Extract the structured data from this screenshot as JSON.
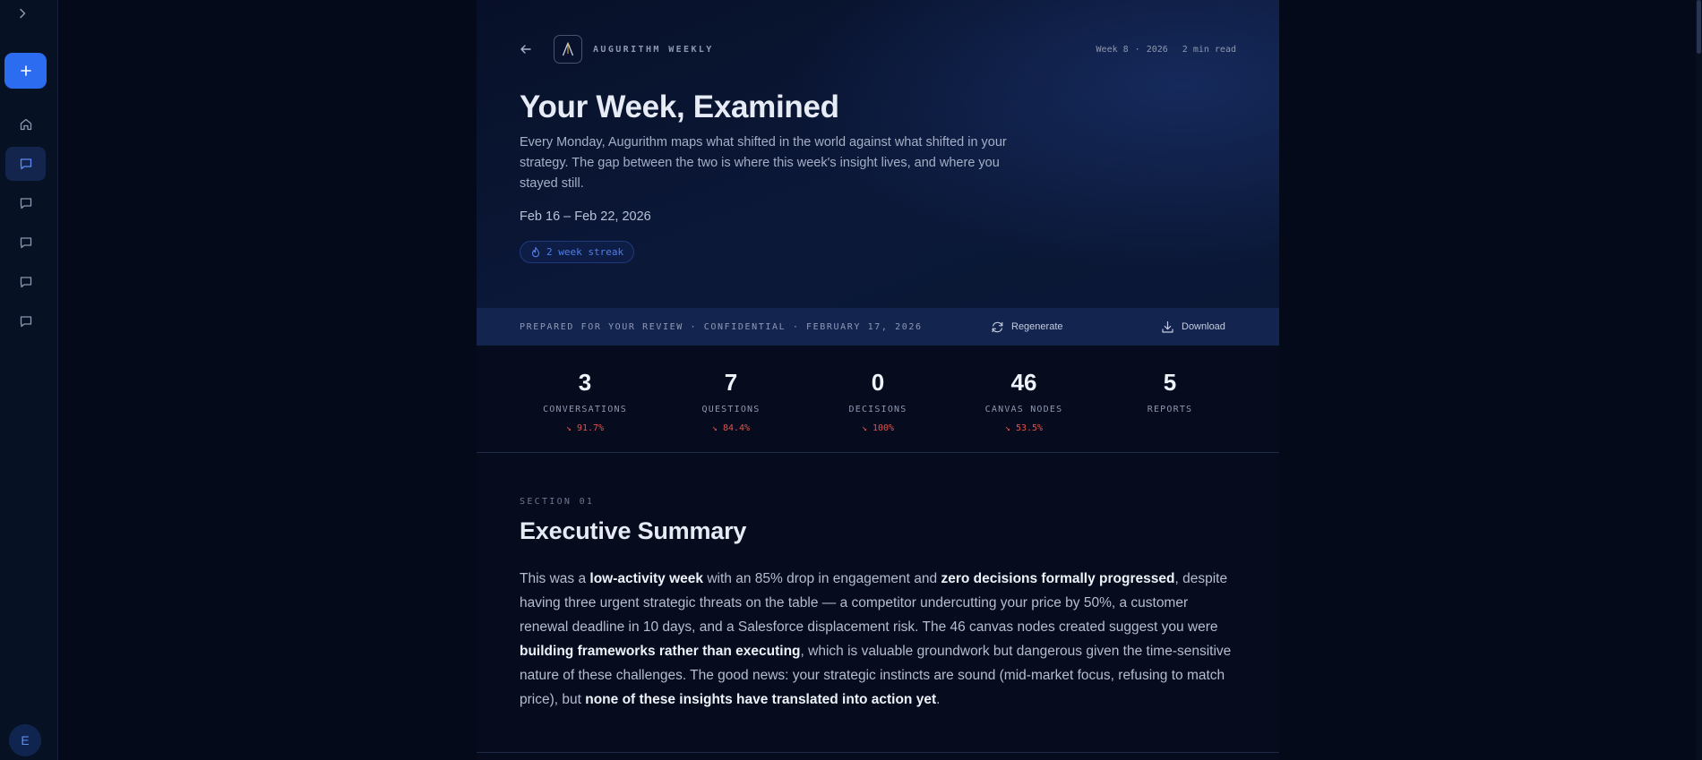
{
  "header": {
    "brand": "AUGURITHM WEEKLY",
    "week": "Week 8",
    "year": "2026",
    "separator": "·",
    "read_time": "2 min read"
  },
  "hero": {
    "title": "Your Week, Examined",
    "subtitle": "Every Monday, Augurithm maps what shifted in the world against what shifted in your strategy. The gap between the two is where this week's insight lives, and where you stayed still.",
    "date_range": "Feb 16 – Feb 22, 2026",
    "streak": "2 week streak"
  },
  "review_bar": {
    "label": "PREPARED FOR YOUR REVIEW · CONFIDENTIAL · FEBRUARY 17, 2026",
    "regenerate": "Regenerate",
    "download": "Download"
  },
  "stats": [
    {
      "value": "3",
      "label": "CONVERSATIONS",
      "delta": "↘ 91.7%"
    },
    {
      "value": "7",
      "label": "QUESTIONS",
      "delta": "↘ 84.4%"
    },
    {
      "value": "0",
      "label": "DECISIONS",
      "delta": "↘ 100%"
    },
    {
      "value": "46",
      "label": "CANVAS NODES",
      "delta": "↘ 53.5%"
    },
    {
      "value": "5",
      "label": "REPORTS",
      "delta": ""
    }
  ],
  "section": {
    "tag": "SECTION 01",
    "title": "Executive Summary",
    "summary": {
      "p1": "This was a ",
      "b1": "low-activity week",
      "p2": " with an 85% drop in engagement and ",
      "b2": "zero decisions formally progressed",
      "p3": ", despite having three urgent strategic threats on the table — a competitor undercutting your price by 50%, a customer renewal deadline in 10 days, and a Salesforce displacement risk. The 46 canvas nodes created suggest you were ",
      "b3": "building frameworks rather than executing",
      "p4": ", which is valuable groundwork but dangerous given the time-sensitive nature of these challenges. The good news: your strategic instincts are sound (mid-market focus, refusing to match price), but ",
      "b4": "none of these insights have translated into action yet",
      "p5": "."
    }
  },
  "sidebar": {
    "avatar_initial": "E",
    "icons": [
      "chevron-right-icon",
      "plus-icon",
      "home-icon",
      "chat-icon",
      "chat-icon",
      "chat-icon",
      "chat-icon",
      "chat-icon"
    ]
  },
  "colors": {
    "accent": "#2c6cf0",
    "negative": "#e3544d",
    "background": "#050a1a",
    "review_bar": "#13244f"
  }
}
